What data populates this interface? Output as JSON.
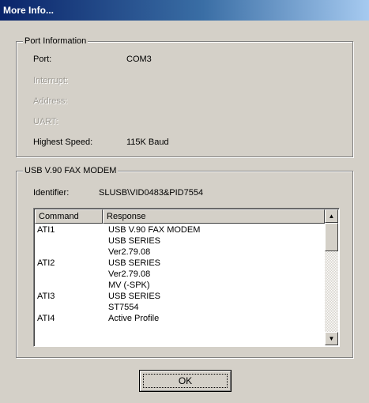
{
  "window": {
    "title": "More Info..."
  },
  "port_info": {
    "group_title": "Port Information",
    "port_label": "Port:",
    "port_value": "COM3",
    "interrupt_label": "Interrupt:",
    "address_label": "Address:",
    "uart_label": "UART:",
    "speed_label": "Highest Speed:",
    "speed_value": "115K Baud"
  },
  "modem": {
    "group_title": "USB V.90 FAX MODEM",
    "identifier_label": "Identifier:",
    "identifier_value": "SLUSB\\VID0483&PID7554",
    "list": {
      "col_command": "Command",
      "col_response": "Response",
      "rows": [
        {
          "command": "ATI1",
          "response": "USB V.90 FAX MODEM"
        },
        {
          "command": "",
          "response": "USB SERIES"
        },
        {
          "command": "",
          "response": "Ver2.79.08"
        },
        {
          "command": "ATI2",
          "response": "USB SERIES"
        },
        {
          "command": "",
          "response": "Ver2.79.08"
        },
        {
          "command": "",
          "response": "MV (-SPK)"
        },
        {
          "command": "ATI3",
          "response": "USB SERIES"
        },
        {
          "command": "",
          "response": "ST7554"
        },
        {
          "command": "ATI4",
          "response": "Active Profile"
        }
      ]
    }
  },
  "buttons": {
    "ok_label": "OK"
  }
}
